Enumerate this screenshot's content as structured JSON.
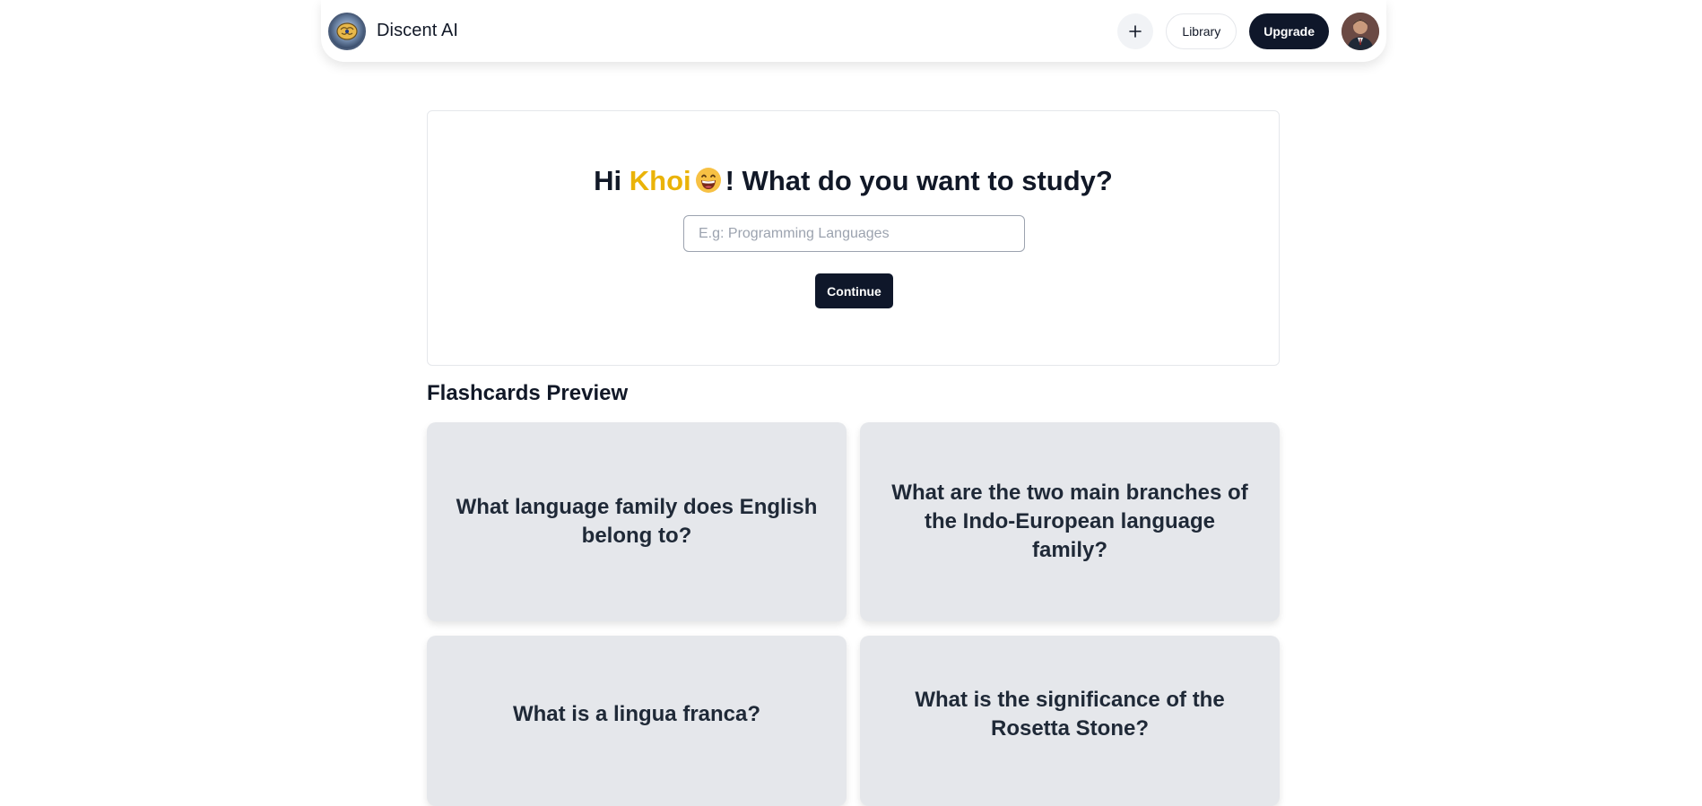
{
  "header": {
    "brand_name": "Discent AI",
    "logo_icon": "brain-logo-icon",
    "new_icon": "plus-icon",
    "library_label": "Library",
    "upgrade_label": "Upgrade",
    "avatar_icon": "user-avatar"
  },
  "study": {
    "greeting_prefix": "Hi ",
    "user_name": "Khoi",
    "emoji_icon": "grinning-face-emoji",
    "greeting_suffix": "! What do you want to study?",
    "input_value": "",
    "input_placeholder": "E.g: Programming Languages",
    "continue_label": "Continue"
  },
  "flashcards": {
    "section_title": "Flashcards Preview",
    "cards": [
      {
        "question": "What language family does English belong to?"
      },
      {
        "question": "What are the two main branches of the Indo-European language family?"
      },
      {
        "question": "What is a lingua franca?"
      },
      {
        "question": "What is the significance of the Rosetta Stone?"
      }
    ]
  },
  "colors": {
    "primary_dark": "#0f172a",
    "accent_name": "#eab308",
    "card_bg": "#e5e7eb"
  }
}
